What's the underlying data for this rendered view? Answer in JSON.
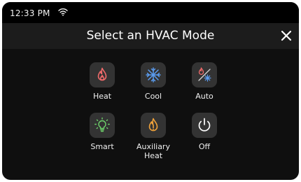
{
  "status_bar": {
    "time": "12:33 PM",
    "wifi_icon": "wifi-icon"
  },
  "header": {
    "title": "Select an HVAC Mode",
    "close_icon": "close-icon"
  },
  "modes": [
    {
      "label": "Heat",
      "icon": "flame-icon",
      "color": "#f26b6b"
    },
    {
      "label": "Cool",
      "icon": "snowflake-icon",
      "color": "#5b9cf0"
    },
    {
      "label": "Auto",
      "icon": "flame-snowflake-icon",
      "color": "#f26b6b"
    },
    {
      "label": "Smart",
      "icon": "lightbulb-icon",
      "color": "#6ed36b"
    },
    {
      "label": "Auxiliary Heat",
      "label_line1": "Auxiliary",
      "label_line2": "Heat",
      "icon": "warning-flame-icon",
      "color": "#f0a23a"
    },
    {
      "label": "Off",
      "icon": "power-icon",
      "color": "#ffffff"
    }
  ],
  "colors": {
    "background": "#0f0f0f",
    "header": "#1c1c1c",
    "tile": "#333333"
  }
}
